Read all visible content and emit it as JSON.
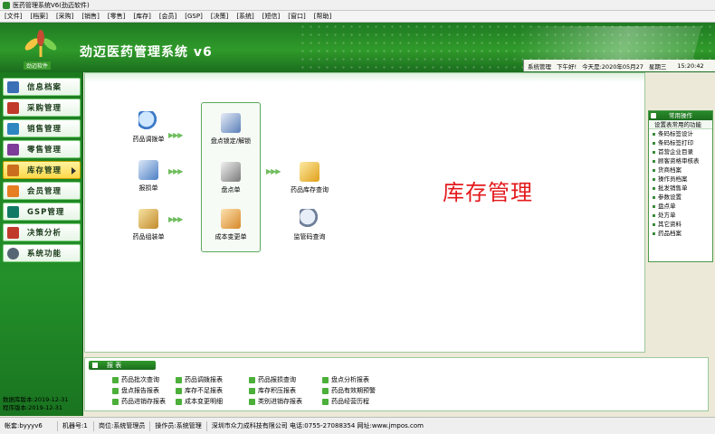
{
  "window": {
    "title": "医药管理系统V6(劲迈软件)"
  },
  "menu": [
    "[文件]",
    "[档案]",
    "[采购]",
    "[销售]",
    "[零售]",
    "[库存]",
    "[会员]",
    "[GSP]",
    "[决策]",
    "[系统]",
    "[短信]",
    "[窗口]",
    "[帮助]"
  ],
  "header": {
    "app_title": "劲迈医药管理系统 v6",
    "logo_caption": "劲迈软件",
    "status_user": "系统管理",
    "status_greeting": "下午好!",
    "status_date": "今天是:2020年05月27",
    "status_weekday": "星期三",
    "status_time": "15:20:42"
  },
  "sidebar": {
    "items": [
      {
        "label": "信息档案",
        "icon": "info-icon",
        "color": "#3b6fb6"
      },
      {
        "label": "采购管理",
        "icon": "cart-icon",
        "color": "#c0392b"
      },
      {
        "label": "销售管理",
        "icon": "sale-icon",
        "color": "#2e86c1"
      },
      {
        "label": "零售管理",
        "icon": "shop-icon",
        "color": "#7d3c98"
      },
      {
        "label": "库存管理",
        "icon": "inventory-icon",
        "color": "#ca6f1e"
      },
      {
        "label": "会员管理",
        "icon": "member-icon",
        "color": "#e67e22"
      },
      {
        "label": "GSP管理",
        "icon": "gsp-icon",
        "color": "#117a65"
      },
      {
        "label": "决策分析",
        "icon": "chart-icon",
        "color": "#c0392b"
      },
      {
        "label": "系统功能",
        "icon": "gear-icon",
        "color": "#566573"
      }
    ],
    "active_index": 4,
    "footer_line1": "数据库版本:2019-12-31",
    "footer_line2": "程序版本:2019-12-31"
  },
  "main": {
    "title": "库存管理",
    "functions": {
      "transfer": "药品调拨单",
      "report_loss": "报损单",
      "assemble": "药品组装单",
      "stocktake_lock": "盘点锁定/解锁",
      "stocktake": "盘点单",
      "cost_change": "成本变更单",
      "stock_query": "药品库存查询",
      "supervision_query": "监管码查询"
    }
  },
  "right_panel": {
    "header": "常用操作",
    "sub": "设置表常用的功能",
    "items": [
      "条码标签设计",
      "条码标签打印",
      "首营企业目录",
      "顾客资格审核表",
      "货商档案",
      "操作员档案",
      "批发销售单",
      "参数设置",
      "盘点单",
      "处方单",
      "其它资料",
      "药品档案"
    ]
  },
  "reports": {
    "header": "报 表",
    "links": [
      [
        "药品批次查询",
        "药品调拨报表",
        "药品报损查询",
        "盘点分析报表"
      ],
      [
        "盘点报告报表",
        "库存不足报表",
        "库存积压报表",
        "药品有效期预警"
      ],
      [
        "药品进销存报表",
        "成本变更明细",
        "类别进销存报表",
        "药品经营历程"
      ]
    ]
  },
  "statusbar": {
    "account": "帐套:byyyv6",
    "machine": "机器号:1",
    "role": "岗位:系统管理员",
    "operator": "操作员:系统管理",
    "company": "深圳市众力成科技有限公司 电话:0755-27088354 网址:www.jmpos.com"
  }
}
